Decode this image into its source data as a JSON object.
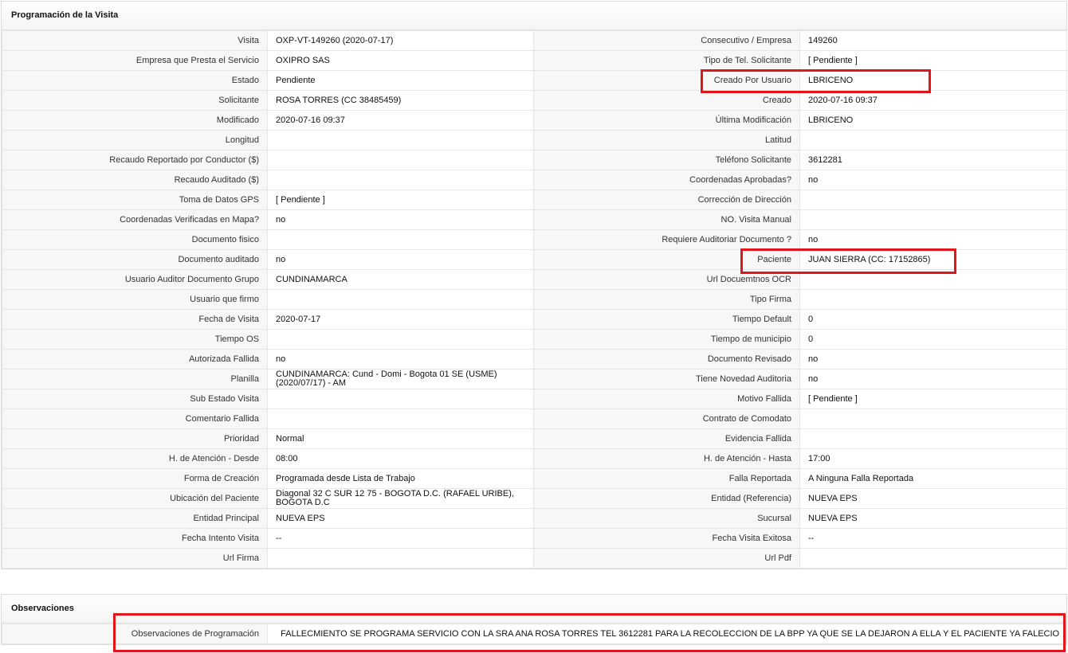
{
  "section_visit": {
    "title": "Programación de la Visita",
    "rows": [
      {
        "l1": "Visita",
        "v1": "OXP-VT-149260 (2020-07-17)",
        "l2": "Consecutivo / Empresa",
        "v2": "149260"
      },
      {
        "l1": "Empresa que Presta el Servicio",
        "v1": "OXIPRO SAS",
        "l2": "Tipo de Tel. Solicitante",
        "v2": "[ Pendiente ]"
      },
      {
        "l1": "Estado",
        "v1": "Pendiente",
        "l2": "Creado Por Usuario",
        "v2": "LBRICENO"
      },
      {
        "l1": "Solicitante",
        "v1": "ROSA TORRES (CC 38485459)",
        "l2": "Creado",
        "v2": "2020-07-16 09:37"
      },
      {
        "l1": "Modificado",
        "v1": "2020-07-16 09:37",
        "l2": "Última Modificación",
        "v2": " LBRICENO"
      },
      {
        "l1": "Longitud",
        "v1": "",
        "l2": "Latitud",
        "v2": ""
      },
      {
        "l1": "Recaudo Reportado por Conductor ($)",
        "v1": "",
        "l2": "Teléfono Solicitante",
        "v2": "3612281"
      },
      {
        "l1": "Recaudo Auditado ($)",
        "v1": "",
        "l2": "Coordenadas Aprobadas?",
        "v2": " no"
      },
      {
        "l1": "Toma de Datos GPS",
        "v1": "[ Pendiente ]",
        "l2": "Corrección de Dirección",
        "v2": ""
      },
      {
        "l1": "Coordenadas Verificadas en Mapa?",
        "v1": " no",
        "l2": "NO. Visita Manual",
        "v2": ""
      },
      {
        "l1": "Documento fisico",
        "v1": "",
        "l2": "Requiere Auditoriar Documento ?",
        "v2": " no"
      },
      {
        "l1": "Documento auditado",
        "v1": " no",
        "l2": "Paciente",
        "v2": "JUAN SIERRA (CC: 17152865)"
      },
      {
        "l1": "Usuario Auditor Documento Grupo",
        "v1": "CUNDINAMARCA",
        "l2": "Url Docuemtnos OCR",
        "v2": ""
      },
      {
        "l1": "Usuario que firmo",
        "v1": "",
        "l2": "Tipo Firma",
        "v2": ""
      },
      {
        "l1": "Fecha de Visita",
        "v1": " 2020-07-17",
        "l2": "Tiempo Default",
        "v2": "0"
      },
      {
        "l1": "Tiempo OS",
        "v1": "",
        "l2": "Tiempo de municipio",
        "v2": "0"
      },
      {
        "l1": "Autorizada Fallida",
        "v1": " no",
        "l2": "Documento Revisado",
        "v2": " no"
      },
      {
        "l1": "Planilla",
        "v1": "CUNDINAMARCA: Cund - Domi - Bogota 01 SE (USME) (2020/07/17) - AM",
        "l2": "Tiene Novedad Auditoria",
        "v2": " no"
      },
      {
        "l1": "Sub Estado Visita",
        "v1": "",
        "l2": "Motivo Fallida",
        "v2": "[ Pendiente ]"
      },
      {
        "l1": "Comentario Fallida",
        "v1": "",
        "l2": "Contrato de Comodato",
        "v2": ""
      },
      {
        "l1": "Prioridad",
        "v1": "Normal",
        "l2": "Evidencia Fallida",
        "v2": ""
      },
      {
        "l1": "H. de Atención - Desde",
        "v1": "08:00",
        "l2": "H. de Atención - Hasta",
        "v2": "17:00"
      },
      {
        "l1": "Forma de Creación",
        "v1": "Programada desde Lista de Trabajo",
        "l2": "Falla Reportada",
        "v2": "A Ninguna Falla Reportada"
      },
      {
        "l1": "Ubicación del Paciente",
        "v1": "Diagonal 32 C SUR 12 75 - BOGOTA D.C. (RAFAEL URIBE), BOGOTA D.C",
        "l2": "Entidad (Referencia)",
        "v2": "NUEVA EPS"
      },
      {
        "l1": "Entidad Principal",
        "v1": "NUEVA EPS",
        "l2": "Sucursal",
        "v2": "NUEVA EPS"
      },
      {
        "l1": "Fecha Intento Visita",
        "v1": " --",
        "l2": "Fecha Visita Exitosa",
        "v2": " --"
      },
      {
        "l1": "Url Firma",
        "v1": "",
        "l2": "Url Pdf",
        "v2": ""
      }
    ]
  },
  "section_obs": {
    "title": "Observaciones",
    "label": "Observaciones de Programación",
    "value": "  FALLECMIENTO SE PROGRAMA SERVICIO CON LA SRA ANA ROSA TORRES TEL 3612281 PARA LA RECOLECCION DE LA BPP YA QUE SE LA DEJARON A ELLA Y EL PACIENTE YA FALECIO"
  },
  "colors": {
    "highlight": "#e2151b",
    "label_bg": "#f7f7f7",
    "border": "#e6e6e6"
  }
}
